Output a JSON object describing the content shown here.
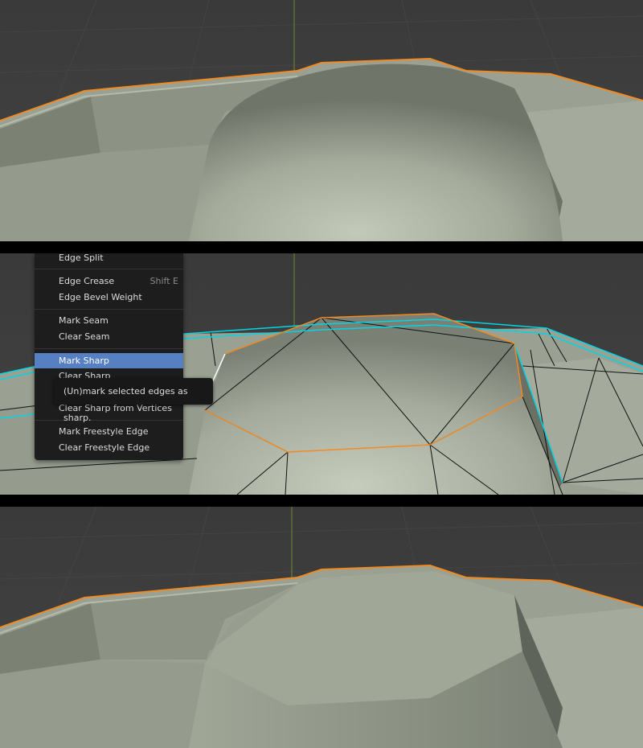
{
  "context_menu": {
    "items": [
      {
        "label": "Edge Split",
        "shortcut": ""
      },
      {
        "label": "Edge Crease",
        "shortcut": "Shift E"
      },
      {
        "label": "Edge Bevel Weight",
        "shortcut": ""
      },
      {
        "label": "Mark Seam",
        "shortcut": ""
      },
      {
        "label": "Clear Seam",
        "shortcut": ""
      },
      {
        "label": "Mark Sharp",
        "shortcut": ""
      },
      {
        "label": "Clear Sharp",
        "shortcut": ""
      },
      {
        "label": "Clear Sharp from Vertices",
        "shortcut": ""
      },
      {
        "label": "Mark Freestyle Edge",
        "shortcut": ""
      },
      {
        "label": "Clear Freestyle Edge",
        "shortcut": ""
      }
    ],
    "highlighted_item": "Mark Sharp"
  },
  "tooltip": {
    "text": "(Un)mark selected edges as sharp."
  },
  "colors": {
    "viewport_background": "#3d3d3d",
    "mesh_surface": "#9ea596",
    "selected_edge": "#f08a24",
    "sharp_edge": "#00d5e6",
    "menu_highlight": "#5680c2",
    "axis_line": "#6f8a30"
  }
}
